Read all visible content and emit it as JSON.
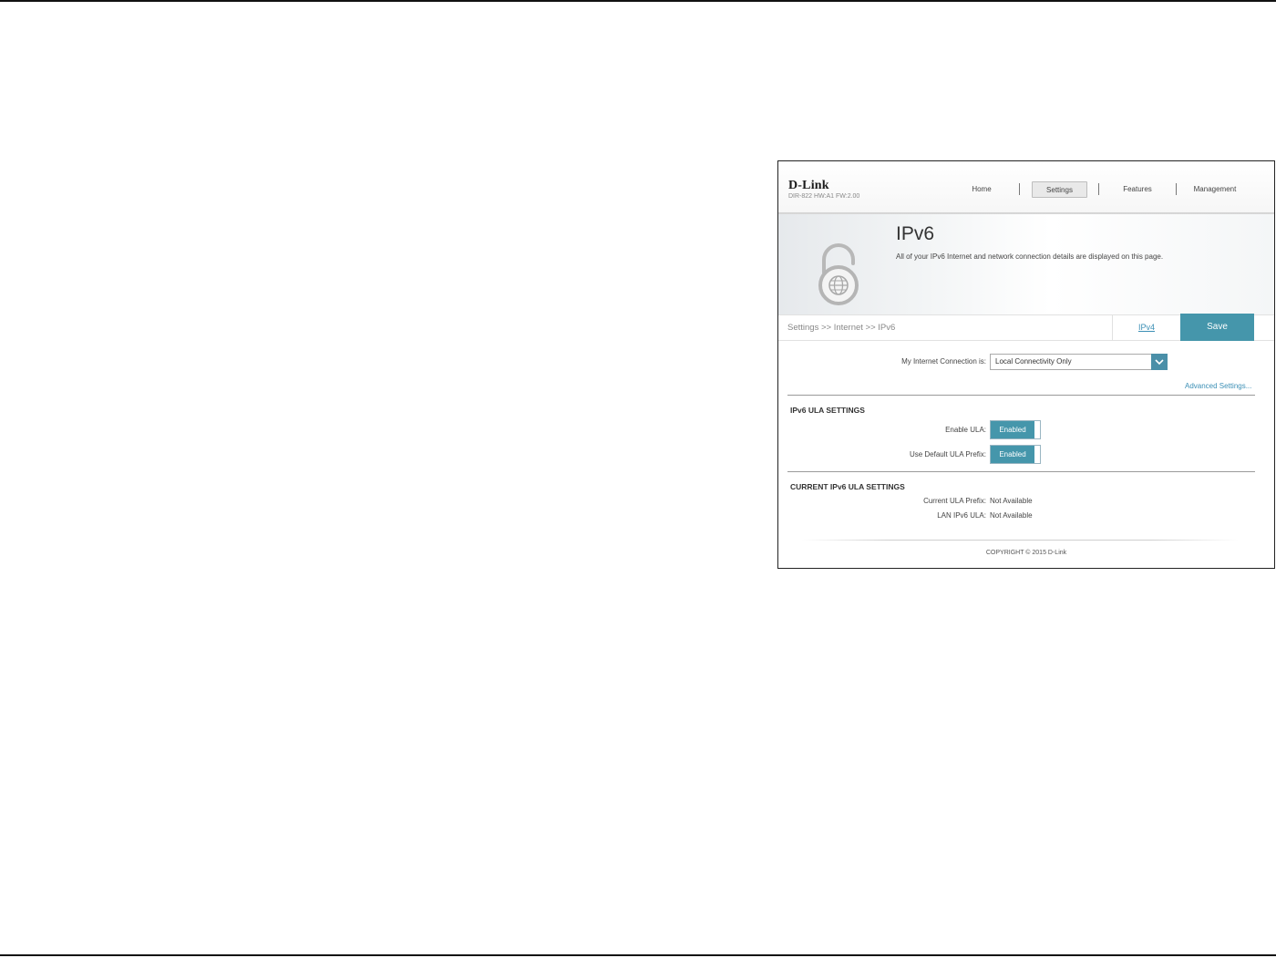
{
  "header": {
    "logo": "D-Link",
    "firmware": "DIR-822 HW:A1 FW:2.00",
    "nav": {
      "home": "Home",
      "settings": "Settings",
      "features": "Features",
      "management": "Management"
    }
  },
  "banner": {
    "title": "IPv6",
    "description": "All of your IPv6 Internet and network connection details are displayed on this page.",
    "icon": "lock-globe-icon"
  },
  "breadcrumb": "Settings >> Internet >> IPv6",
  "tabs": {
    "ipv4": "IPv4",
    "save": "Save"
  },
  "connection": {
    "label": "My Internet Connection is:",
    "value": "Local Connectivity Only",
    "advanced": "Advanced Settings..."
  },
  "ula_settings": {
    "heading": "IPv6 ULA SETTINGS",
    "enable_ula_label": "Enable ULA:",
    "enable_ula_value": "Enabled",
    "default_prefix_label": "Use Default ULA Prefix:",
    "default_prefix_value": "Enabled"
  },
  "current_ula": {
    "heading": "CURRENT IPv6 ULA SETTINGS",
    "prefix_label": "Current ULA Prefix:",
    "prefix_value": "Not Available",
    "lan_label": "LAN IPv6 ULA:",
    "lan_value": "Not Available"
  },
  "footer": {
    "copyright": "COPYRIGHT © 2015 D-Link"
  },
  "colors": {
    "accent": "#4596ab",
    "link": "#3b8fb5"
  }
}
